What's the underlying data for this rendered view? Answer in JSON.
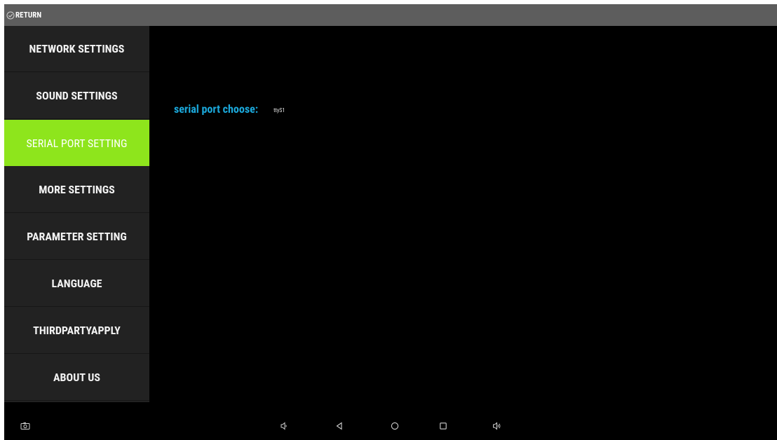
{
  "topbar": {
    "return_label": "RETURN",
    "return_icon": "check-circle-icon"
  },
  "sidebar": {
    "items": [
      {
        "label": "NETWORK SETTINGS",
        "active": false
      },
      {
        "label": "SOUND SETTINGS",
        "active": false
      },
      {
        "label": "SERIAL PORT SETTING",
        "active": true
      },
      {
        "label": "MORE SETTINGS",
        "active": false
      },
      {
        "label": "PARAMETER SETTING",
        "active": false
      },
      {
        "label": "LANGUAGE",
        "active": false
      },
      {
        "label": "THIRDPARTYAPPLY",
        "active": false
      },
      {
        "label": "ABOUT US",
        "active": false
      }
    ]
  },
  "main": {
    "serial_label": "serial port choose:",
    "serial_value": "ttyS1"
  },
  "navbar": {
    "icons": [
      "screenshot-icon",
      "volume-down-icon",
      "back-icon",
      "home-icon",
      "recents-icon",
      "volume-up-icon"
    ]
  },
  "colors": {
    "active_accent": "#8ee51c",
    "label_accent": "#1ba9dc",
    "sidebar_bg": "#222222",
    "topbar_bg": "#5d5d5d",
    "screen_bg": "#000000"
  }
}
